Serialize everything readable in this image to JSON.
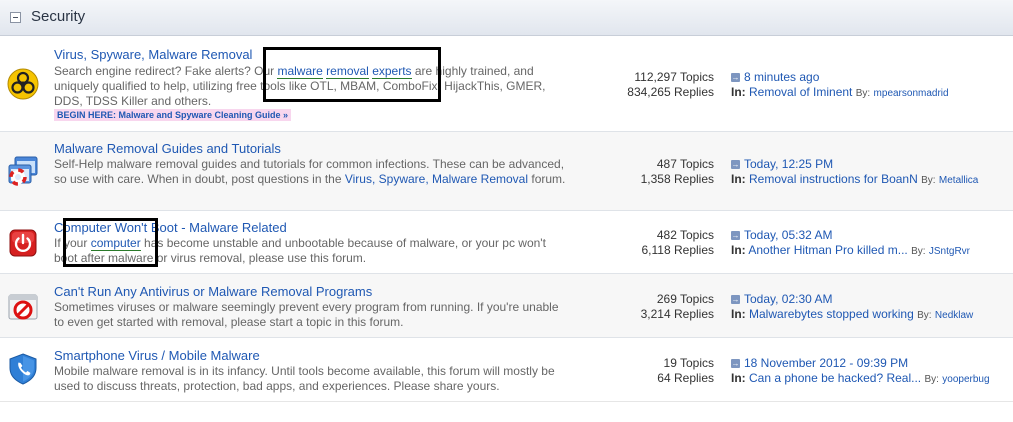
{
  "category": {
    "title": "Security"
  },
  "forums": [
    {
      "title": "Virus, Spyware, Malware Removal",
      "desc_parts": {
        "a": "Search engine redirect? Fake alerts? Our ",
        "kw1": "malware",
        "kw2": "removal",
        "kw3": "experts",
        "b": " are highly trained, and uniquely qualified to help, utilizing free tools like OTL, MBAM, ComboFix, HijackThis, GMER, DDS, TDSS Killer and others."
      },
      "badge": "BEGIN HERE: Malware and Spyware Cleaning Guide »",
      "topics": "112,297 Topics",
      "replies": "834,265 Replies",
      "last_time": "8 minutes ago",
      "last_in_label": "In:",
      "last_topic": "Removal of Iminent",
      "by_label": "By:",
      "last_user": "mpearsonmadrid"
    },
    {
      "title": "Malware Removal Guides and Tutorials",
      "desc_parts": {
        "a": "Self-Help malware removal guides and tutorials for common infections. These can be advanced, so use with care. When in doubt, post questions in the ",
        "link": "Virus, Spyware, Malware Removal",
        "b": " forum."
      },
      "topics": "487 Topics",
      "replies": "1,358 Replies",
      "last_time": "Today, 12:25 PM",
      "last_in_label": "In:",
      "last_topic": "Removal instructions for BoanN",
      "by_label": "By:",
      "last_user": "Metallica"
    },
    {
      "title": "Computer Won't Boot - Malware Related",
      "desc_parts": {
        "a": "If your ",
        "kw1": "computer",
        "b": " has become unstable and unbootable because of malware, or your pc won't boot after malware or virus removal, please use this forum."
      },
      "topics": "482 Topics",
      "replies": "6,118 Replies",
      "last_time": "Today, 05:32 AM",
      "last_in_label": "In:",
      "last_topic": "Another Hitman Pro killed m...",
      "by_label": "By:",
      "last_user": "JSntgRvr"
    },
    {
      "title": "Can't Run Any Antivirus or Malware Removal Programs",
      "desc": "Sometimes viruses or malware seemingly prevent every program from running. If you're unable to even get started with removal, please start a topic in this forum.",
      "topics": "269 Topics",
      "replies": "3,214 Replies",
      "last_time": "Today, 02:30 AM",
      "last_in_label": "In:",
      "last_topic": "Malwarebytes stopped working",
      "by_label": "By:",
      "last_user": "Nedklaw"
    },
    {
      "title": "Smartphone Virus / Mobile Malware",
      "desc": "Mobile malware removal is in its infancy. Until tools become available, this forum will mostly be used to discuss threats, protection, bad apps, and experiences. Please share yours.",
      "topics": "19 Topics",
      "replies": "64 Replies",
      "last_time": "18 November 2012 - 09:39 PM",
      "last_in_label": "In:",
      "last_topic": "Can a phone be hacked? Real...",
      "by_label": "By:",
      "last_user": "yooperbug"
    }
  ],
  "icons": {
    "row1": "biohazard-icon",
    "row2": "lifebuoy-window-icon",
    "row3": "power-button-icon",
    "row4": "blocked-window-icon",
    "row5": "shield-phone-icon"
  },
  "colors": {
    "link": "#1f58b3",
    "keyword": "#2a7a2a",
    "badge_bg": "#f8d6ee",
    "header_bg": "#e1e6ee"
  }
}
